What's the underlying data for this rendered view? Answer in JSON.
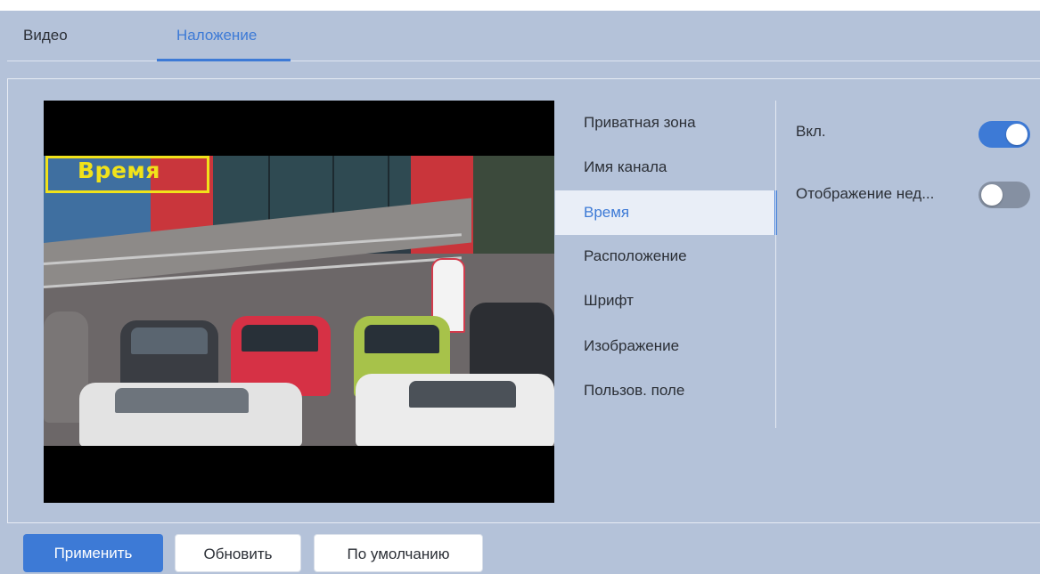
{
  "tabs": [
    {
      "label": "Видео",
      "active": false
    },
    {
      "label": "Наложение",
      "active": true
    }
  ],
  "preview": {
    "osd_label": "Время",
    "osd_color": "#f1e21a"
  },
  "menu": {
    "items": [
      {
        "label": "Приватная зона"
      },
      {
        "label": "Имя канала"
      },
      {
        "label": "Время",
        "active": true
      },
      {
        "label": "Расположение"
      },
      {
        "label": "Шрифт"
      },
      {
        "label": "Изображение"
      },
      {
        "label": "Пользов. поле"
      }
    ]
  },
  "settings": {
    "enable": {
      "label": "Вкл.",
      "on": true
    },
    "show_week": {
      "label": "Отображение нед...",
      "on": false
    }
  },
  "buttons": {
    "apply": "Применить",
    "refresh": "Обновить",
    "default": "По умолчанию"
  },
  "colors": {
    "accent": "#3d7ad6",
    "background": "#b4c2d9"
  }
}
